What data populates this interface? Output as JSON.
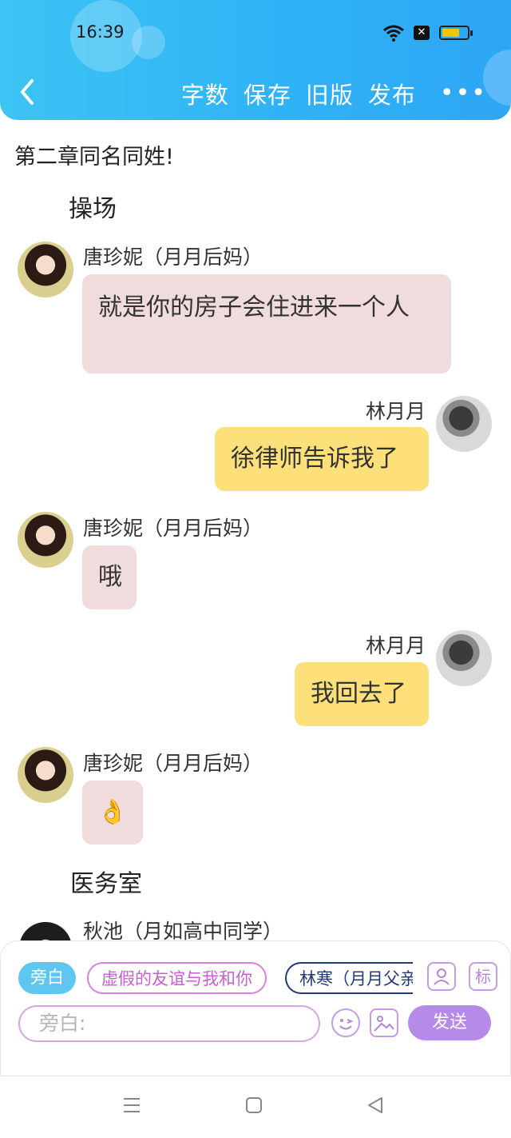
{
  "status": {
    "time": "16:39"
  },
  "header": {
    "actions": [
      "字数",
      "保存",
      "旧版",
      "发布"
    ],
    "more": "•••"
  },
  "content": {
    "chapter_title": "第二章同名同姓!",
    "scenes": [
      "操场",
      "医务室"
    ],
    "messages": [
      {
        "side": "left",
        "name": "唐珍妮（月月后妈）",
        "text": "就是你的房子会住进来一个人"
      },
      {
        "side": "right",
        "name": "林月月",
        "text": "徐律师告诉我了"
      },
      {
        "side": "left",
        "name": "唐珍妮（月月后妈）",
        "text": "哦"
      },
      {
        "side": "right",
        "name": "林月月",
        "text": "我回去了"
      },
      {
        "side": "left",
        "name": "唐珍妮（月月后妈）",
        "text": "👌"
      },
      {
        "side": "left",
        "name": "秋池（月如高中同学）",
        "text": ""
      }
    ]
  },
  "composer": {
    "roles": [
      "旁白",
      "虚假的友谊与我和你",
      "林寒（月月父亲"
    ],
    "icon_btn_label": "标",
    "input_placeholder": "旁白:",
    "send_label": "发送"
  },
  "colors": {
    "header": "#2fb1f6",
    "pink_bubble": "#f0dcdc",
    "yellow_bubble": "#fde07a",
    "send_button": "#b68ae8"
  }
}
